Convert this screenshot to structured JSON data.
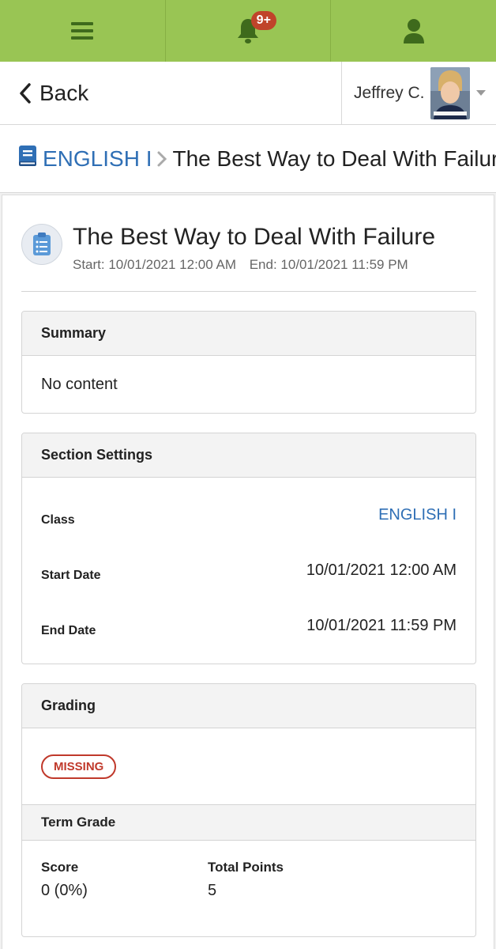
{
  "topnav": {
    "menu_icon": "hamburger-icon",
    "bell_icon": "bell-icon",
    "notification_count": "9+",
    "user_icon": "person-icon",
    "colors": {
      "bar": "#99c554",
      "icon": "#3e6a1c",
      "badge": "#c0442a"
    }
  },
  "backbar": {
    "back_label": "Back",
    "user_name": "Jeffrey C."
  },
  "breadcrumb": {
    "course": "ENGLISH I",
    "current": "The Best Way to Deal With Failure"
  },
  "assignment": {
    "title": "The Best Way to Deal With Failure",
    "start": "Start: 10/01/2021 12:00 AM",
    "end": "End: 10/01/2021 11:59 PM"
  },
  "summary": {
    "heading": "Summary",
    "content": "No content"
  },
  "settings": {
    "heading": "Section Settings",
    "rows": [
      {
        "label": "Class",
        "value": "ENGLISH I"
      },
      {
        "label": "Start Date",
        "value": "10/01/2021 12:00 AM"
      },
      {
        "label": "End Date",
        "value": "10/01/2021 11:59 PM"
      }
    ]
  },
  "grading": {
    "heading": "Grading",
    "status_badge": "MISSING",
    "term_heading": "Term Grade",
    "score_label": "Score",
    "score_value": "0 (0%)",
    "total_label": "Total Points",
    "total_value": "5"
  },
  "colors": {
    "link": "#2f6fb5",
    "missing": "#c0392b"
  }
}
